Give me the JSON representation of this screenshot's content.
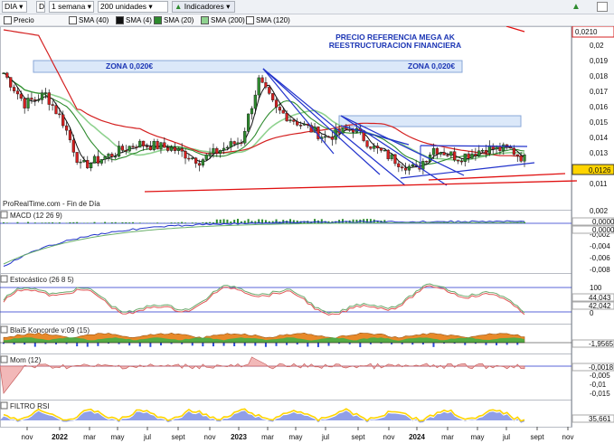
{
  "toolbar": {
    "symbol": "DIA",
    "interval_letter": "D",
    "period": "1 semana",
    "units": "200 unidades",
    "indicators": "Indicadores"
  },
  "legend": [
    {
      "label": "Precio",
      "color": "#ffffff"
    },
    {
      "label": "SMA (40)",
      "color": "#ffffff"
    },
    {
      "label": "SMA (4)",
      "color": "#111111"
    },
    {
      "label": "SMA (20)",
      "color": "#2e8b2e"
    },
    {
      "label": "SMA (200)",
      "color": "#8fd28f"
    },
    {
      "label": "SMA (120)",
      "color": "#ffffff"
    }
  ],
  "annotations": {
    "zona_left": "ZONA 0,020€",
    "zona_right": "ZONA 0,020€",
    "precio_line1": "PRECIO REFERENCIA MEGA AK",
    "precio_line2": "REESTRUCTURACION FINANCIERA",
    "source": "ProRealTime.com - Fin de Día"
  },
  "price_axis": {
    "top_badge": "0,0210",
    "current_badge": "0,0126",
    "ticks": [
      "0,02",
      "0,019",
      "0,018",
      "0,017",
      "0,016",
      "0,015",
      "0,014",
      "0,013",
      "0,012",
      "0,011"
    ]
  },
  "panels": {
    "macd": {
      "title": "MACD (12 26 9)",
      "ticks": [
        "0,002",
        "0",
        "-0,002",
        "-0,004",
        "-0,006",
        "-0,008"
      ],
      "badges": [
        "0,0000",
        "0,0000"
      ]
    },
    "stoch": {
      "title": "Estocástico (26 8 5)",
      "ticks": [
        "100",
        "0"
      ],
      "badges": [
        "44,043",
        "42,042"
      ]
    },
    "blai": {
      "title": "Blai5 Koncorde v:09 (15)",
      "ticks": [
        "0"
      ],
      "badges": [
        "-1,9565"
      ]
    },
    "mom": {
      "title": "Mom (12)",
      "ticks": [
        "0",
        "-0,005",
        "-0,01",
        "-0,015"
      ],
      "badges": [
        "-0,0018"
      ]
    },
    "rsi": {
      "title": "FILTRO RSI",
      "ticks": [],
      "badges": [
        "35,661"
      ]
    }
  },
  "x_axis": [
    "nov",
    "2022",
    "mar",
    "may",
    "jul",
    "sept",
    "nov",
    "2023",
    "mar",
    "may",
    "jul",
    "sept",
    "nov",
    "2024",
    "mar",
    "may",
    "jul",
    "sept",
    "nov"
  ],
  "colors": {
    "up": "#2e8b2e",
    "down": "#d42020",
    "sma40": "#d42020",
    "sma4": "#111111",
    "sma20": "#2e8b2e",
    "sma200": "#8fd28f",
    "trend": "#2233cc",
    "support": "#e01010"
  }
}
